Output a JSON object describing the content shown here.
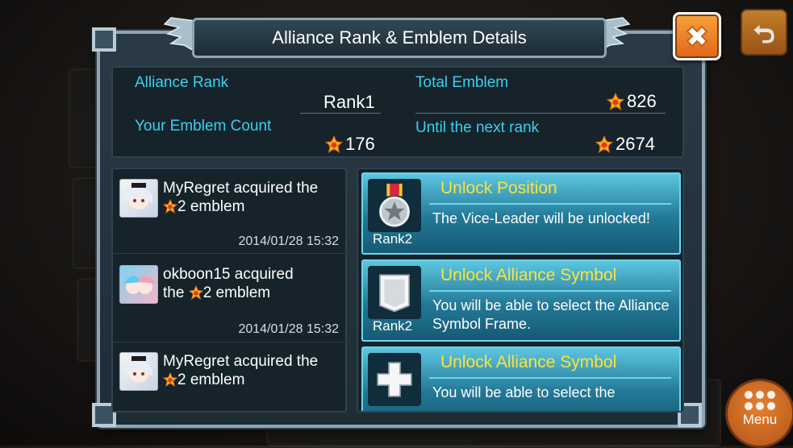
{
  "dialog": {
    "title": "Alliance Rank & Emblem Details"
  },
  "stats": {
    "alliance_rank_label": "Alliance Rank",
    "alliance_rank_value": "Rank1",
    "total_emblem_label": "Total Emblem",
    "total_emblem_value": "826",
    "your_emblem_label": "Your Emblem Count",
    "your_emblem_value": "176",
    "next_rank_label": "Until the next rank",
    "next_rank_value": "2674"
  },
  "feed": [
    {
      "name": "MyRegret",
      "line1": "MyRegret acquired the",
      "line2": "2 emblem",
      "time": "2014/01/28 15:32"
    },
    {
      "name": "okboon15",
      "line1": "okboon15 acquired",
      "line2_prefix": "the",
      "line2": "2 emblem",
      "time": "2014/01/28 15:32"
    },
    {
      "name": "MyRegret",
      "line1": "MyRegret acquired the",
      "line2": "2 emblem"
    }
  ],
  "unlocks": [
    {
      "title": "Unlock Position",
      "desc": "The Vice-Leader will be unlocked!",
      "rank": "Rank2",
      "icon": "medal-icon"
    },
    {
      "title": "Unlock Alliance Symbol",
      "desc": "You will be able to select the Alliance Symbol Frame.",
      "rank": "Rank2",
      "icon": "shield-frame-icon"
    },
    {
      "title": "Unlock Alliance Symbol",
      "desc": "You will be able to select the",
      "icon": "cross-symbol-icon"
    }
  ],
  "buttons": {
    "menu_label": "Menu"
  },
  "colors": {
    "accent_cyan": "#38d1ef",
    "title_yellow": "#ffe13a",
    "close_orange": "#f08a2a"
  }
}
